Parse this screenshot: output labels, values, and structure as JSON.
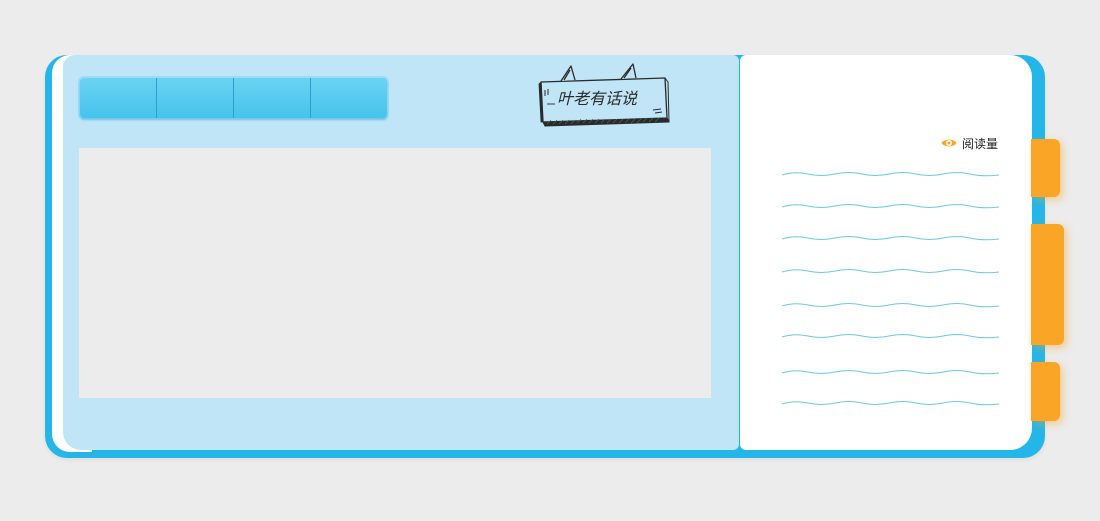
{
  "nav": {
    "tabs": [
      {
        "label": ""
      },
      {
        "label": ""
      },
      {
        "label": ""
      },
      {
        "label": ""
      }
    ]
  },
  "logo": {
    "text": "叶老有话说"
  },
  "sidebar": {
    "read_count_label": "阅读量",
    "icon": "eye-icon"
  },
  "side_tabs": [
    {
      "label": ""
    },
    {
      "label": ""
    },
    {
      "label": ""
    }
  ],
  "colors": {
    "background": "#ececec",
    "book_shell": "#24b6e8",
    "left_page": "#bfe5f7",
    "tab_strip": "#45c3ee",
    "content_area": "#ececed",
    "right_page": "#ffffff",
    "accent_orange": "#fba526",
    "wave_line": "#6cc9e2"
  }
}
